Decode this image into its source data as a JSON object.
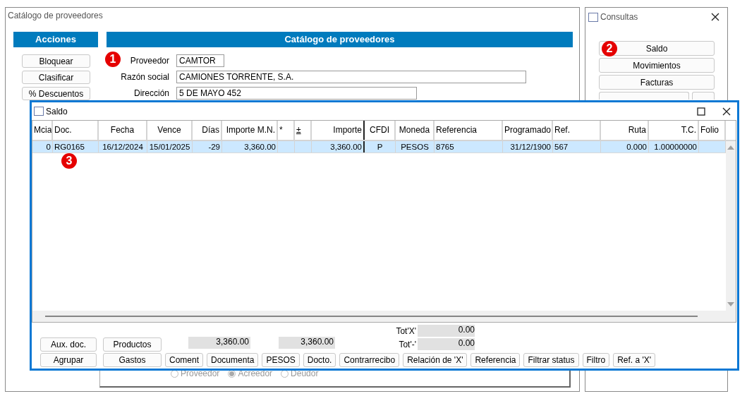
{
  "main_window": {
    "title": "Catálogo de proveedores",
    "actions_header": "Acciones",
    "catalog_header": "Catálogo de proveedores",
    "action_buttons": [
      "Bloquear",
      "Clasificar",
      "% Descuentos"
    ],
    "fields": [
      {
        "label": "Proveedor",
        "value": "CAMTOR"
      },
      {
        "label": "Razón social",
        "value": "CAMIONES TORRENTE, S.A."
      },
      {
        "label": "Dirección",
        "value": "5 DE MAYO 452"
      }
    ],
    "radios": [
      {
        "label": "Proveedor",
        "selected": false
      },
      {
        "label": "Acreedor",
        "selected": true
      },
      {
        "label": "Deudor",
        "selected": false
      }
    ]
  },
  "consultas_window": {
    "title": "Consultas",
    "buttons": [
      "Saldo",
      "Movimientos",
      "Facturas"
    ]
  },
  "saldo_window": {
    "title": "Saldo",
    "table": {
      "columns": [
        "Mcia",
        "Doc.",
        "Fecha",
        "Vence",
        "Días",
        "Importe M.N.",
        "*",
        "±",
        "Importe",
        "CFDI",
        "Moneda",
        "Referencia",
        "Programado",
        "Ref.",
        "Ruta",
        "T.C.",
        "Folio"
      ],
      "rows": [
        {
          "selected": true,
          "cells": [
            "0",
            "RG0165",
            "16/12/2024",
            "15/01/2025",
            "-29",
            "3,360.00",
            null,
            null,
            "3,360.00",
            "P",
            "PESOS",
            "8765",
            "31/12/1900",
            "567",
            "0.000",
            "1.00000000",
            null
          ]
        }
      ]
    },
    "buttons_row_1": [
      "Aux. doc.",
      "Productos"
    ],
    "totals": [
      "3,360.00",
      "3,360.00"
    ],
    "tot_fields": [
      {
        "label": "Tot'X'",
        "value": "0.00"
      },
      {
        "label": "Tot'-'",
        "value": "0.00"
      }
    ],
    "buttons_row_2": [
      "Agrupar",
      "Gastos",
      "Coment",
      "Documenta",
      "PESOS",
      "Docto.",
      "Contrarrecibo",
      "Relación de 'X'",
      "Referencia",
      "Filtrar status",
      "Filtro",
      "Ref. a 'X'"
    ]
  },
  "markers": [
    "1",
    "2",
    "3"
  ]
}
